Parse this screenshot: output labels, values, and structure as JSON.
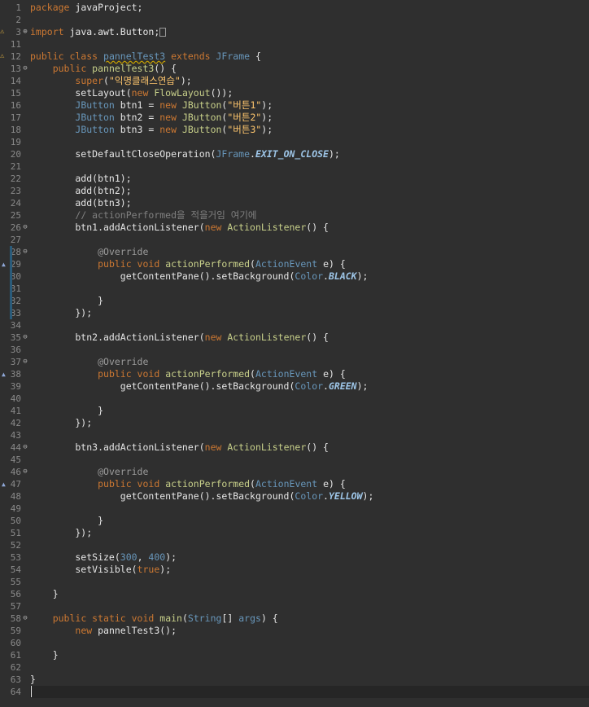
{
  "editor": {
    "language": "java",
    "first_line": 1,
    "line_numbers": [
      "1",
      "2",
      "3",
      "11",
      "12",
      "13",
      "14",
      "15",
      "16",
      "17",
      "18",
      "19",
      "20",
      "21",
      "22",
      "23",
      "24",
      "25",
      "26",
      "27",
      "28",
      "29",
      "30",
      "31",
      "32",
      "33",
      "34",
      "35",
      "36",
      "37",
      "38",
      "39",
      "40",
      "41",
      "42",
      "43",
      "44",
      "45",
      "46",
      "47",
      "48",
      "49",
      "50",
      "51",
      "52",
      "53",
      "54",
      "55",
      "56",
      "57",
      "58",
      "59",
      "60",
      "61",
      "62",
      "63",
      "64"
    ],
    "gutter_icons": {
      "warning": [
        "3",
        "12"
      ],
      "fold_expand": [
        "3"
      ],
      "fold_collapse": [
        "13",
        "26",
        "28",
        "35",
        "37",
        "44",
        "46",
        "58"
      ],
      "override_markers": [
        "29",
        "38",
        "47"
      ]
    },
    "lines": [
      [
        [
          "kw",
          "package "
        ],
        [
          "txt",
          "javaProject;"
        ]
      ],
      [],
      [
        [
          "kw",
          "import "
        ],
        [
          "txt",
          "java.awt.Button;"
        ]
      ],
      [],
      [
        [
          "kw",
          "public class "
        ],
        [
          "cls",
          "pannelTest3"
        ],
        [
          "kw",
          " extends "
        ],
        [
          "cls",
          "JFrame"
        ],
        [
          "txt",
          " {"
        ]
      ],
      [
        [
          "txt",
          "    "
        ],
        [
          "kw",
          "public "
        ],
        [
          "fn",
          "pannelTest3"
        ],
        [
          "txt",
          "() {"
        ]
      ],
      [
        [
          "txt",
          "        "
        ],
        [
          "kw",
          "super"
        ],
        [
          "txt",
          "("
        ],
        [
          "str",
          "\"익명클래스연습\""
        ],
        [
          "txt",
          ");"
        ]
      ],
      [
        [
          "txt",
          "        setLayout("
        ],
        [
          "kw",
          "new "
        ],
        [
          "fn",
          "FlowLayout"
        ],
        [
          "txt",
          "());"
        ]
      ],
      [
        [
          "txt",
          "        "
        ],
        [
          "cls",
          "JButton"
        ],
        [
          "txt",
          " btn1 = "
        ],
        [
          "kw",
          "new "
        ],
        [
          "fn",
          "JButton"
        ],
        [
          "txt",
          "("
        ],
        [
          "str",
          "\"버튼1\""
        ],
        [
          "txt",
          ");"
        ]
      ],
      [
        [
          "txt",
          "        "
        ],
        [
          "cls",
          "JButton"
        ],
        [
          "txt",
          " btn2 = "
        ],
        [
          "kw",
          "new "
        ],
        [
          "fn",
          "JButton"
        ],
        [
          "txt",
          "("
        ],
        [
          "str",
          "\"버튼2\""
        ],
        [
          "txt",
          ");"
        ]
      ],
      [
        [
          "txt",
          "        "
        ],
        [
          "cls",
          "JButton"
        ],
        [
          "txt",
          " btn3 = "
        ],
        [
          "kw",
          "new "
        ],
        [
          "fn",
          "JButton"
        ],
        [
          "txt",
          "("
        ],
        [
          "str",
          "\"버튼3\""
        ],
        [
          "txt",
          ");"
        ]
      ],
      [],
      [
        [
          "txt",
          "        setDefaultCloseOperation("
        ],
        [
          "cls",
          "JFrame"
        ],
        [
          "txt",
          "."
        ],
        [
          "const",
          "EXIT_ON_CLOSE"
        ],
        [
          "txt",
          ");"
        ]
      ],
      [],
      [
        [
          "txt",
          "        add(btn1);"
        ]
      ],
      [
        [
          "txt",
          "        add(btn2);"
        ]
      ],
      [
        [
          "txt",
          "        add(btn3);"
        ]
      ],
      [
        [
          "txt",
          "        "
        ],
        [
          "cmt",
          "// actionPerformed을 적을거임 여기에"
        ]
      ],
      [
        [
          "txt",
          "        btn1.addActionListener("
        ],
        [
          "kw",
          "new "
        ],
        [
          "fn",
          "ActionListener"
        ],
        [
          "txt",
          "() {"
        ]
      ],
      [],
      [
        [
          "txt",
          "            "
        ],
        [
          "ann",
          "@Override"
        ]
      ],
      [
        [
          "txt",
          "            "
        ],
        [
          "kw",
          "public void "
        ],
        [
          "fn",
          "actionPerformed"
        ],
        [
          "txt",
          "("
        ],
        [
          "cls",
          "ActionEvent"
        ],
        [
          "txt",
          " e) {"
        ]
      ],
      [
        [
          "txt",
          "                getContentPane().setBackground("
        ],
        [
          "cls",
          "Color"
        ],
        [
          "txt",
          "."
        ],
        [
          "const",
          "BLACK"
        ],
        [
          "txt",
          ");"
        ]
      ],
      [],
      [
        [
          "txt",
          "            }"
        ]
      ],
      [
        [
          "txt",
          "        });"
        ]
      ],
      [],
      [
        [
          "txt",
          "        btn2.addActionListener("
        ],
        [
          "kw",
          "new "
        ],
        [
          "fn",
          "ActionListener"
        ],
        [
          "txt",
          "() {"
        ]
      ],
      [],
      [
        [
          "txt",
          "            "
        ],
        [
          "ann",
          "@Override"
        ]
      ],
      [
        [
          "txt",
          "            "
        ],
        [
          "kw",
          "public void "
        ],
        [
          "fn",
          "actionPerformed"
        ],
        [
          "txt",
          "("
        ],
        [
          "cls",
          "ActionEvent"
        ],
        [
          "txt",
          " e) {"
        ]
      ],
      [
        [
          "txt",
          "                getContentPane().setBackground("
        ],
        [
          "cls",
          "Color"
        ],
        [
          "txt",
          "."
        ],
        [
          "const",
          "GREEN"
        ],
        [
          "txt",
          ");"
        ]
      ],
      [],
      [
        [
          "txt",
          "            }"
        ]
      ],
      [
        [
          "txt",
          "        });"
        ]
      ],
      [],
      [
        [
          "txt",
          "        btn3.addActionListener("
        ],
        [
          "kw",
          "new "
        ],
        [
          "fn",
          "ActionListener"
        ],
        [
          "txt",
          "() {"
        ]
      ],
      [],
      [
        [
          "txt",
          "            "
        ],
        [
          "ann",
          "@Override"
        ]
      ],
      [
        [
          "txt",
          "            "
        ],
        [
          "kw",
          "public void "
        ],
        [
          "fn",
          "actionPerformed"
        ],
        [
          "txt",
          "("
        ],
        [
          "cls",
          "ActionEvent"
        ],
        [
          "txt",
          " e) {"
        ]
      ],
      [
        [
          "txt",
          "                getContentPane().setBackground("
        ],
        [
          "cls",
          "Color"
        ],
        [
          "txt",
          "."
        ],
        [
          "const",
          "YELLOW"
        ],
        [
          "txt",
          ");"
        ]
      ],
      [],
      [
        [
          "txt",
          "            }"
        ]
      ],
      [
        [
          "txt",
          "        });"
        ]
      ],
      [],
      [
        [
          "txt",
          "        setSize("
        ],
        [
          "num",
          "300"
        ],
        [
          "txt",
          ", "
        ],
        [
          "num",
          "400"
        ],
        [
          "txt",
          ");"
        ]
      ],
      [
        [
          "txt",
          "        setVisible("
        ],
        [
          "kw",
          "true"
        ],
        [
          "txt",
          ");"
        ]
      ],
      [],
      [
        [
          "txt",
          "    }"
        ]
      ],
      [],
      [
        [
          "txt",
          "    "
        ],
        [
          "kw",
          "public static void "
        ],
        [
          "fn",
          "main"
        ],
        [
          "txt",
          "("
        ],
        [
          "cls",
          "String"
        ],
        [
          "txt",
          "[] "
        ],
        [
          "cls",
          "args"
        ],
        [
          "txt",
          ") {"
        ]
      ],
      [
        [
          "txt",
          "        "
        ],
        [
          "kw",
          "new "
        ],
        [
          "txt",
          "pannelTest3();"
        ]
      ],
      [],
      [
        [
          "txt",
          "    }"
        ]
      ],
      [],
      [
        [
          "txt",
          "}"
        ]
      ],
      []
    ],
    "colors": {
      "background": "#2f2f2f",
      "current_line": "#262626",
      "keyword": "#cc7832",
      "type": "#6897bb",
      "string": "#ffc66d",
      "comment": "#808080"
    }
  }
}
